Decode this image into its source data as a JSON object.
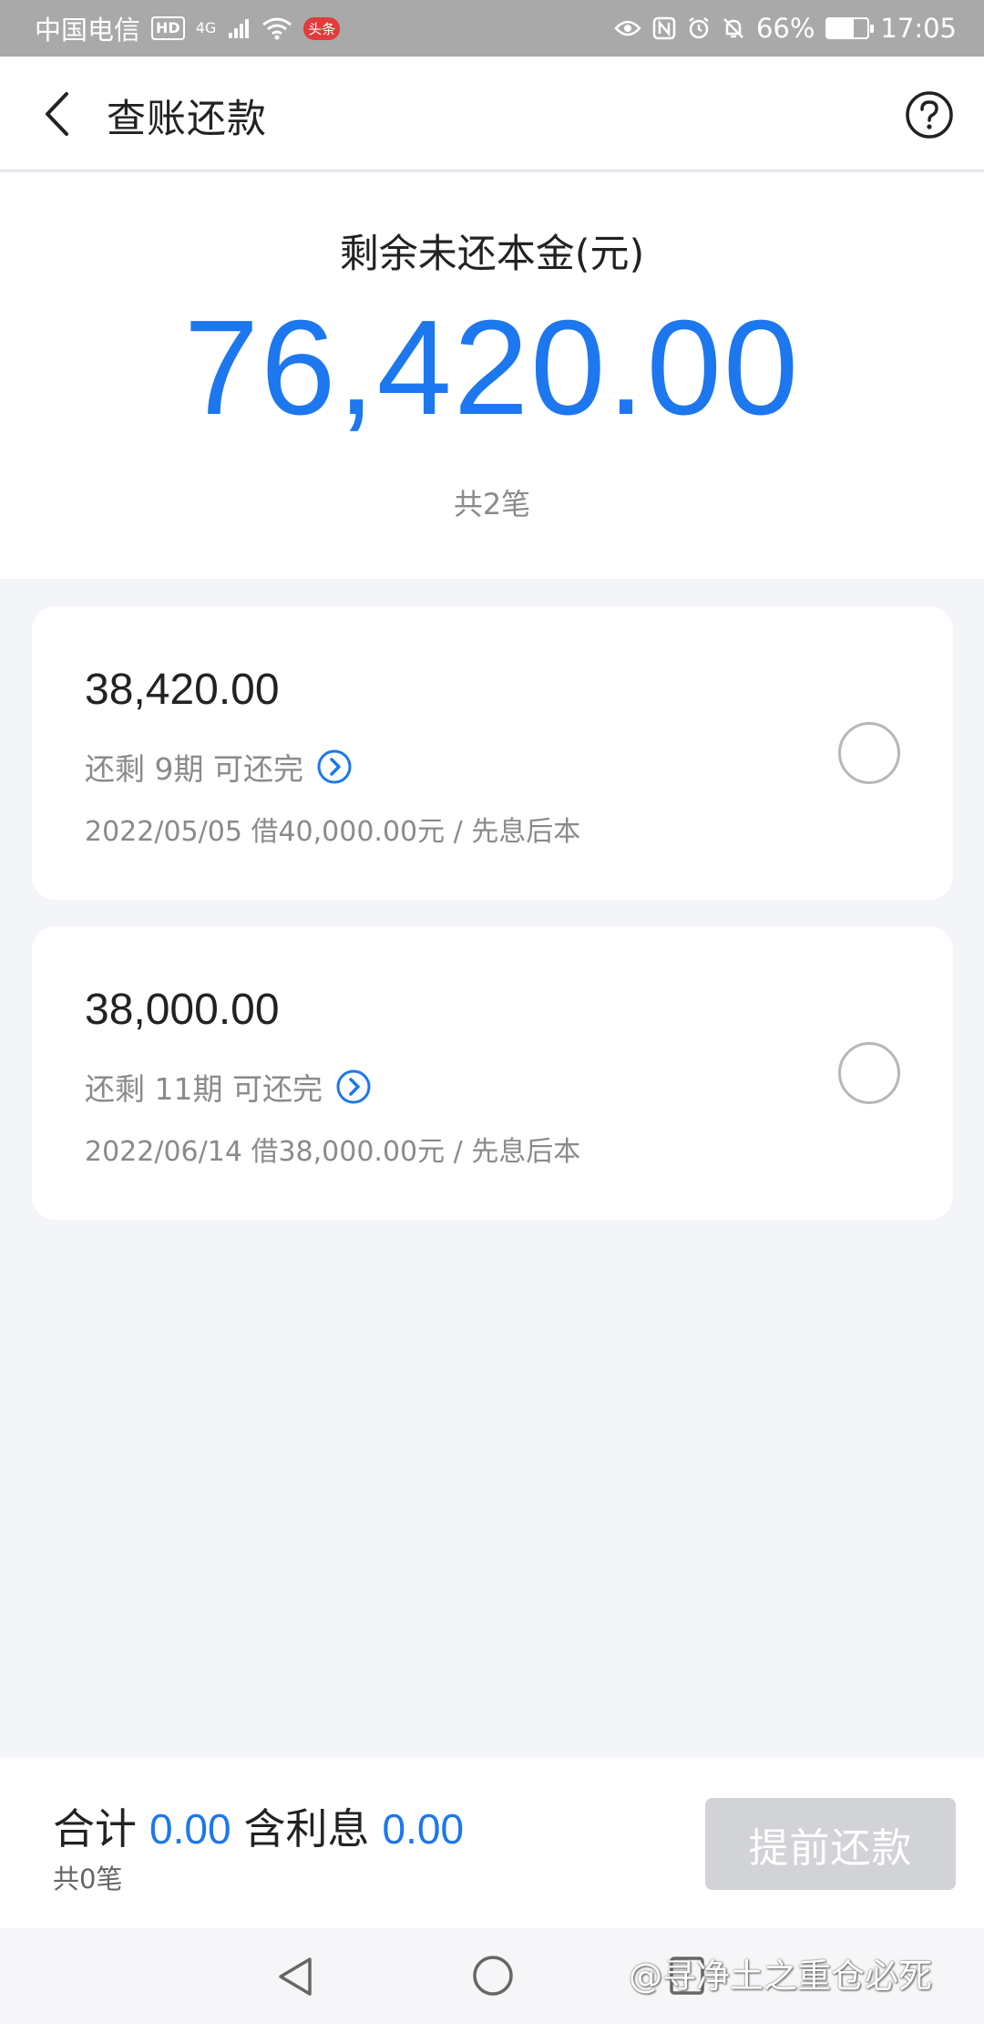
{
  "status_bar": {
    "carrier": "中国电信",
    "hd_badge": "HD",
    "network": "4G",
    "news_badge": "头条",
    "battery_percent": "66%",
    "battery_level": 0.66,
    "time": "17:05",
    "icons": [
      "eye-icon",
      "nfc-icon",
      "alarm-icon",
      "mute-bell-icon"
    ]
  },
  "header": {
    "title": "查账还款",
    "back_icon": "chevron-left-icon",
    "help_icon": "question-circle-icon"
  },
  "summary": {
    "label": "剩余未还本金(元)",
    "amount": "76,420.00",
    "count": "共2笔"
  },
  "loans": [
    {
      "amount": "38,420.00",
      "remaining": "还剩 9期 可还完",
      "detail": "2022/05/05 借40,000.00元 / 先息后本",
      "selected": false
    },
    {
      "amount": "38,000.00",
      "remaining": "还剩 11期 可还完",
      "detail": "2022/06/14 借38,000.00元 / 先息后本",
      "selected": false
    }
  ],
  "bottom": {
    "total_label": "合计",
    "total_value": "0.00",
    "interest_label": "含利息",
    "interest_value": "0.00",
    "count": "共0笔",
    "button_label": "提前还款"
  },
  "watermark": "@寻净土之重仓必死",
  "colors": {
    "accent": "#1d77ee",
    "background": "#f4f5f9",
    "disabled_button": "#d2d3d6",
    "status_bar": "#a9a9aa"
  }
}
